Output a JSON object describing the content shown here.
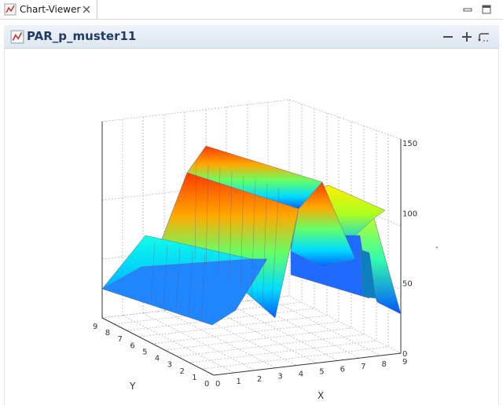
{
  "tab": {
    "label": "Chart-Viewer"
  },
  "header": {
    "title": "PAR_p_muster11"
  },
  "chart_data": {
    "type": "surface",
    "x_ticks": [
      "0",
      "1",
      "2",
      "3",
      "4",
      "5",
      "6",
      "7",
      "8",
      "9"
    ],
    "y_ticks": [
      "0",
      "1",
      "2",
      "3",
      "4",
      "5",
      "6",
      "7",
      "8",
      "9"
    ],
    "z_ticks": [
      "0",
      "50",
      "100",
      "150"
    ],
    "xlabel": "X",
    "ylabel": "Y",
    "zlim": [
      0,
      150
    ],
    "grid": true,
    "legend": "-",
    "colormap": [
      "#0033ff",
      "#00ccff",
      "#33ff99",
      "#ffff00",
      "#ff6600",
      "#ff2200"
    ]
  }
}
